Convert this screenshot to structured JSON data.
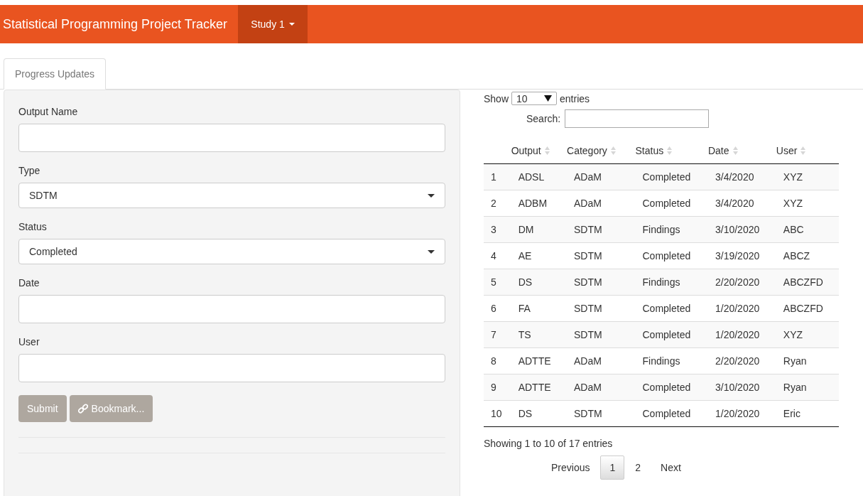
{
  "navbar": {
    "title": "Statistical Programming Project Tracker",
    "menu": "Study 1"
  },
  "tabs": [
    {
      "label": "Progress Updates",
      "selected": true
    }
  ],
  "form": {
    "fields": [
      {
        "kind": "text",
        "label": "Output Name"
      },
      {
        "kind": "select",
        "label": "Type",
        "value": "SDTM"
      },
      {
        "kind": "select",
        "label": "Status",
        "value": "Completed"
      },
      {
        "kind": "text",
        "label": "Date"
      },
      {
        "kind": "text",
        "label": "User"
      }
    ],
    "buttons": [
      {
        "label": "Submit",
        "kind": "plain"
      },
      {
        "label": "Bookmark...",
        "kind": "link"
      }
    ]
  },
  "table": {
    "length": {
      "before": "Show",
      "value": "10",
      "after": "entries"
    },
    "search_label": "Search:",
    "columns": [
      "",
      "Output",
      "Category",
      "Status",
      "Date",
      "User"
    ],
    "rows": [
      [
        "1",
        "ADSL",
        "ADaM",
        "Completed",
        "3/4/2020",
        "XYZ"
      ],
      [
        "2",
        "ADBM",
        "ADaM",
        "Completed",
        "3/4/2020",
        "XYZ"
      ],
      [
        "3",
        "DM",
        "SDTM",
        "Findings",
        "3/10/2020",
        "ABC"
      ],
      [
        "4",
        "AE",
        "SDTM",
        "Completed",
        "3/19/2020",
        "ABCZ"
      ],
      [
        "5",
        "DS",
        "SDTM",
        "Findings",
        "2/20/2020",
        "ABCZFD"
      ],
      [
        "6",
        "FA",
        "SDTM",
        "Completed",
        "1/20/2020",
        "ABCZFD"
      ],
      [
        "7",
        "TS",
        "SDTM",
        "Completed",
        "1/20/2020",
        "XYZ"
      ],
      [
        "8",
        "ADTTE",
        "ADaM",
        "Findings",
        "2/20/2020",
        "Ryan"
      ],
      [
        "9",
        "ADTTE",
        "ADaM",
        "Completed",
        "3/10/2020",
        "Ryan"
      ],
      [
        "10",
        "DS",
        "SDTM",
        "Completed",
        "1/20/2020",
        "Eric"
      ]
    ],
    "info": "Showing 1 to 10 of 17 entries",
    "pagination": {
      "previous": "Previous",
      "next": "Next",
      "pages": [
        {
          "label": "1",
          "selected": true
        },
        {
          "label": "2",
          "selected": false
        }
      ]
    }
  }
}
